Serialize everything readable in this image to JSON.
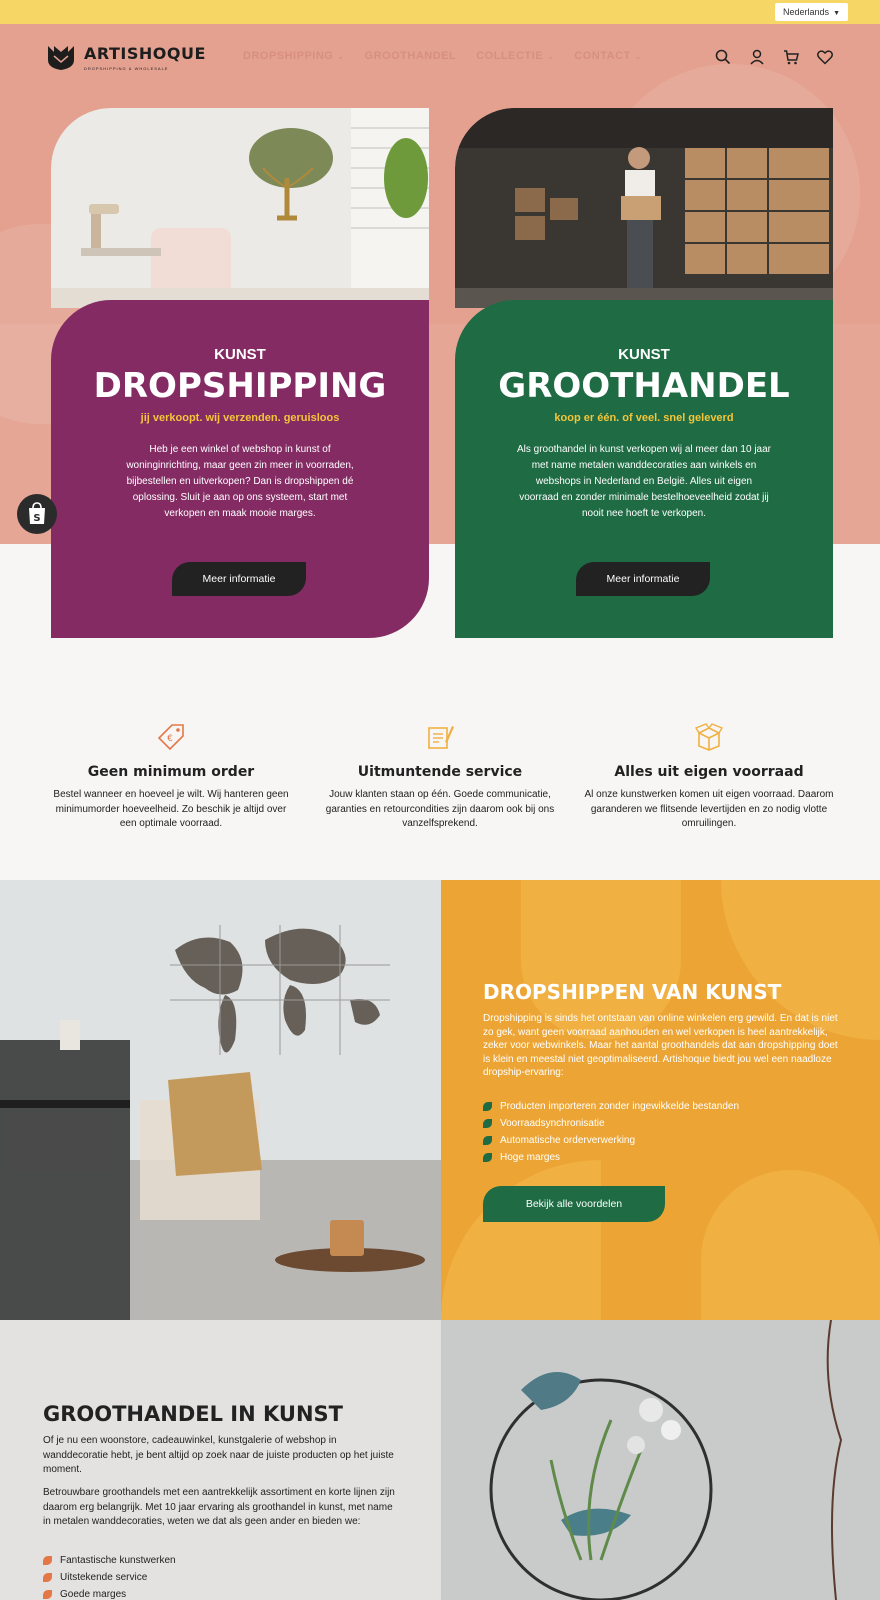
{
  "language_selector": {
    "value": "Nederlands"
  },
  "brand": {
    "name": "ARTISHOQUE",
    "tagline": "DROPSHIPPING & WHOLESALE"
  },
  "nav": [
    {
      "label": "DROPSHIPPING",
      "has_dropdown": true
    },
    {
      "label": "GROOTHANDEL",
      "has_dropdown": false
    },
    {
      "label": "COLLECTIE",
      "has_dropdown": true
    },
    {
      "label": "CONTACT",
      "has_dropdown": true
    }
  ],
  "header_icons": [
    "search-icon",
    "account-icon",
    "cart-icon",
    "wishlist-icon"
  ],
  "cards": [
    {
      "pre_title": "KUNST",
      "title": "DROPSHIPPING",
      "tagline": "jij verkoopt. wij verzenden. geruisloos",
      "body": "Heb je een winkel of webshop in kunst of woninginrichting, maar geen zin meer in voorraden, bijbestellen en uitverkopen? Dan is dropshippen dé oplossing. Sluit je aan op ons systeem, start met verkopen en maak mooie marges.",
      "button": "Meer informatie",
      "panel_color": "#842b64"
    },
    {
      "pre_title": "KUNST",
      "title": "GROOTHANDEL",
      "tagline": "koop er één. of veel. snel geleverd",
      "body": "Als groothandel in kunst verkopen wij al meer dan 10 jaar met name metalen wanddecoraties aan winkels en webshops in Nederland en België. Alles uit eigen voorraad en zonder minimale bestelhoeveelheid zodat jij nooit nee hoeft te verkopen.",
      "button": "Meer informatie",
      "panel_color": "#1e6b44"
    }
  ],
  "features": [
    {
      "icon": "price-tag-icon",
      "title": "Geen minimum order",
      "body": "Bestel wanneer en hoeveel je wilt. Wij hanteren geen minimumorder hoeveelheid. Zo beschik je altijd over een optimale voorraad."
    },
    {
      "icon": "service-form-icon",
      "title": "Uitmuntende service",
      "body": "Jouw klanten staan op één. Goede communicatie, garanties en retourcondities zijn daarom ook bij ons vanzelfsprekend."
    },
    {
      "icon": "box-icon",
      "title": "Alles uit eigen voorraad",
      "body": "Al onze kunstwerken komen uit eigen voorraad. Daarom garanderen we flitsende levertijden en zo nodig vlotte omruilingen."
    }
  ],
  "dropship_section": {
    "title": "DROPSHIPPEN VAN KUNST",
    "body": "Dropshipping is sinds het ontstaan van online winkelen erg gewild. En dat is niet zo gek, want geen voorraad aanhouden en wel verkopen is heel aantrekkelijk, zeker voor webwinkels. Maar het aantal groothandels dat aan dropshipping doet is klein en meestal niet geoptimaliseerd. Artishoque biedt jou wel een naadloze dropship-ervaring:",
    "bullets": [
      "Producten importeren zonder ingewikkelde bestanden",
      "Voorraadsynchronisatie",
      "Automatische orderverwerking",
      "Hoge marges"
    ],
    "button": "Bekijk alle voordelen"
  },
  "wholesale_section": {
    "title": "GROOTHANDEL IN KUNST",
    "p1": "Of je nu een woonstore, cadeauwinkel, kunstgalerie of webshop in wanddecoratie hebt, je bent altijd op zoek naar de juiste producten op het juiste moment.",
    "p2": "Betrouwbare groothandels met een aantrekkelijk assortiment en korte lijnen zijn daarom erg belangrijk. Met 10 jaar ervaring als groothandel in kunst, met name in metalen wanddecoraties, weten we dat als geen ander en bieden we:",
    "bullets": [
      "Fantastische kunstwerken",
      "Uitstekende service",
      "Goede marges"
    ]
  },
  "colors": {
    "topbar": "#f6d664",
    "hero_bg": "#e4a190",
    "dropship_panel": "#842b64",
    "wholesale_panel": "#1e6b44",
    "accent_yellow": "#f3c53a",
    "orange_panel": "#eca535",
    "feature_icon": "#e37846"
  }
}
